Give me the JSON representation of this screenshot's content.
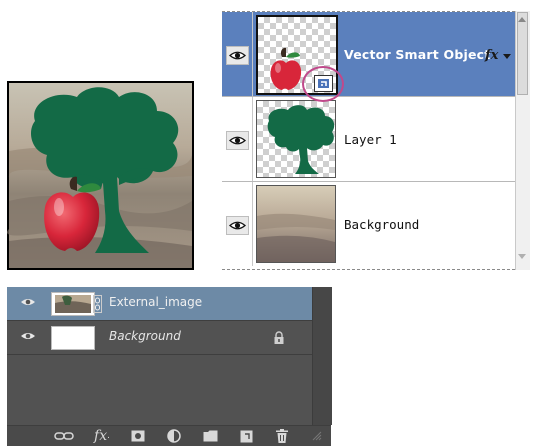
{
  "composite_image": {
    "icon": "apple-tree-landscape-image"
  },
  "layers_panel_light": {
    "layers": [
      {
        "name": "Vector Smart Object",
        "selected": true,
        "thumbnail": "apple-on-transparent",
        "badge_icon": "smart-object-icon",
        "effects_label": "fx"
      },
      {
        "name": "Layer 1",
        "selected": false,
        "thumbnail": "tree-on-transparent"
      },
      {
        "name": "Background",
        "selected": false,
        "thumbnail": "landscape-photo"
      }
    ],
    "colors": {
      "selected": "#5b80bd",
      "highlight_ring": "#c0498b"
    }
  },
  "layers_panel_dark": {
    "layers": [
      {
        "name": "External_image",
        "selected": true,
        "thumbnail": "landscape-photo",
        "italic": false
      },
      {
        "name": "Background",
        "selected": false,
        "thumbnail": "white-fill",
        "italic": true,
        "locked": true
      }
    ],
    "bottom_bar": {
      "fx_label": "fx",
      "icons": [
        "link-layers-icon",
        "add-layer-style-icon",
        "add-mask-icon",
        "adjustment-layer-icon",
        "new-group-icon",
        "new-layer-icon",
        "delete-layer-icon"
      ]
    },
    "colors": {
      "background": "#525252",
      "selected": "#6d8aa6"
    }
  }
}
